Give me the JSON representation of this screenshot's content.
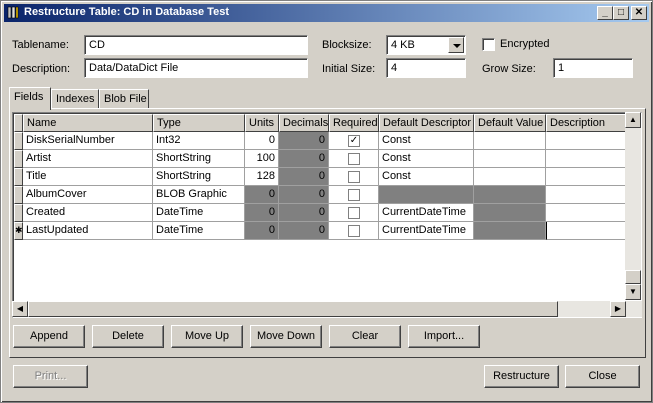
{
  "window": {
    "title": "Restructure Table: CD in Database Test",
    "min_glyph": "_",
    "max_glyph": "□",
    "close_glyph": "✕"
  },
  "form": {
    "tablename_label": "Tablename:",
    "tablename_value": "CD",
    "description_label": "Description:",
    "description_value": "Data/DataDict File",
    "blocksize_label": "Blocksize:",
    "blocksize_value": "4 KB",
    "initial_size_label": "Initial Size:",
    "initial_size_value": "4",
    "encrypted_label": "Encrypted",
    "encrypted_checked": false,
    "grow_size_label": "Grow Size:",
    "grow_size_value": "1"
  },
  "tabs": [
    {
      "label": "Fields",
      "active": true
    },
    {
      "label": "Indexes",
      "active": false
    },
    {
      "label": "Blob File",
      "active": false
    }
  ],
  "grid": {
    "columns": [
      "Name",
      "Type",
      "Units",
      "Decimals",
      "Required",
      "Default Descriptor",
      "Default Value",
      "Description"
    ],
    "rows": [
      {
        "name": "DiskSerialNumber",
        "type": "Int32",
        "units": "0",
        "decimals": "0",
        "required": true,
        "default_descriptor": "Const",
        "default_value": "",
        "description": "",
        "indicator": ""
      },
      {
        "name": "Artist",
        "type": "ShortString",
        "units": "100",
        "decimals": "0",
        "required": false,
        "default_descriptor": "Const",
        "default_value": "",
        "description": "",
        "indicator": ""
      },
      {
        "name": "Title",
        "type": "ShortString",
        "units": "128",
        "decimals": "0",
        "required": false,
        "default_descriptor": "Const",
        "default_value": "",
        "description": "",
        "indicator": ""
      },
      {
        "name": "AlbumCover",
        "type": "BLOB Graphic",
        "units": "0",
        "decimals": "0",
        "required": false,
        "default_descriptor": "",
        "default_value": "",
        "description": "",
        "indicator": ""
      },
      {
        "name": "Created",
        "type": "DateTime",
        "units": "0",
        "decimals": "0",
        "required": false,
        "default_descriptor": "CurrentDateTime",
        "default_value": "",
        "description": "",
        "indicator": ""
      },
      {
        "name": "LastUpdated",
        "type": "DateTime",
        "units": "0",
        "decimals": "0",
        "required": false,
        "default_descriptor": "CurrentDateTime",
        "default_value": "",
        "description": "",
        "indicator": "✱"
      }
    ]
  },
  "actions": {
    "append": "Append",
    "delete": "Delete",
    "move_up": "Move Up",
    "move_down": "Move Down",
    "clear": "Clear",
    "import": "Import..."
  },
  "footer": {
    "print": "Print...",
    "restructure": "Restructure",
    "close": "Close"
  }
}
